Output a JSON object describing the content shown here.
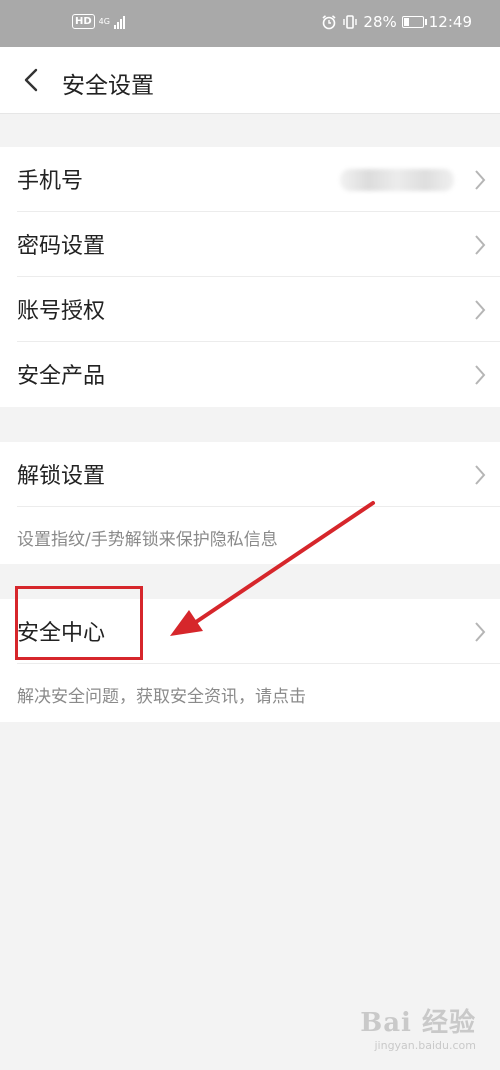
{
  "status_bar": {
    "hd": "HD",
    "network": "4G",
    "battery": "28%",
    "battery_level": 0.28,
    "time": "12:49"
  },
  "header": {
    "title": "安全设置"
  },
  "group1": {
    "items": [
      {
        "label": "手机号"
      },
      {
        "label": "密码设置"
      },
      {
        "label": "账号授权"
      },
      {
        "label": "安全产品"
      }
    ]
  },
  "group2": {
    "label": "解锁设置",
    "description": "设置指纹/手势解锁来保护隐私信息"
  },
  "group3": {
    "label": "安全中心",
    "description": "解决安全问题，获取安全资讯，请点击"
  },
  "annotation_color": "#d6262b",
  "watermark": {
    "main": "Bai 经验",
    "sub": "jingyan.baidu.com"
  }
}
